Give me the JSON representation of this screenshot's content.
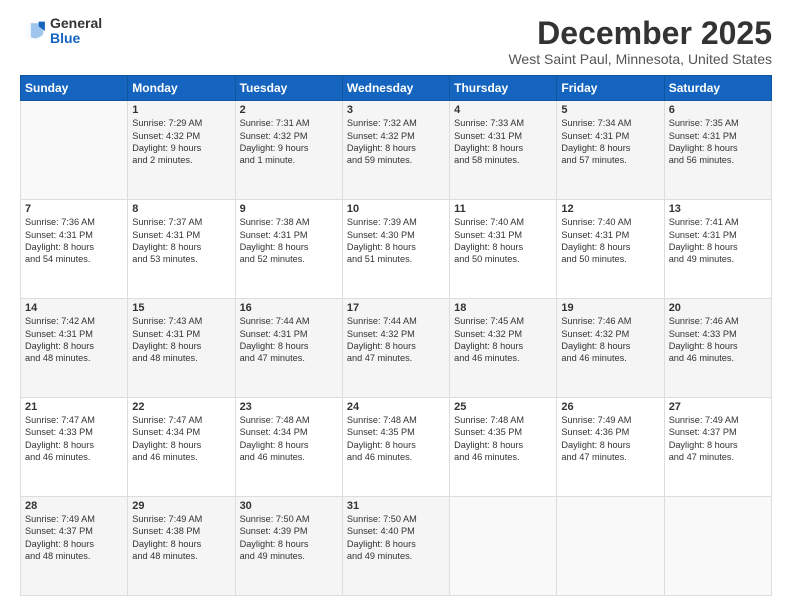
{
  "logo": {
    "general": "General",
    "blue": "Blue"
  },
  "title": "December 2025",
  "location": "West Saint Paul, Minnesota, United States",
  "days_of_week": [
    "Sunday",
    "Monday",
    "Tuesday",
    "Wednesday",
    "Thursday",
    "Friday",
    "Saturday"
  ],
  "weeks": [
    [
      {
        "day": "",
        "info": ""
      },
      {
        "day": "1",
        "info": "Sunrise: 7:29 AM\nSunset: 4:32 PM\nDaylight: 9 hours\nand 2 minutes."
      },
      {
        "day": "2",
        "info": "Sunrise: 7:31 AM\nSunset: 4:32 PM\nDaylight: 9 hours\nand 1 minute."
      },
      {
        "day": "3",
        "info": "Sunrise: 7:32 AM\nSunset: 4:32 PM\nDaylight: 8 hours\nand 59 minutes."
      },
      {
        "day": "4",
        "info": "Sunrise: 7:33 AM\nSunset: 4:31 PM\nDaylight: 8 hours\nand 58 minutes."
      },
      {
        "day": "5",
        "info": "Sunrise: 7:34 AM\nSunset: 4:31 PM\nDaylight: 8 hours\nand 57 minutes."
      },
      {
        "day": "6",
        "info": "Sunrise: 7:35 AM\nSunset: 4:31 PM\nDaylight: 8 hours\nand 56 minutes."
      }
    ],
    [
      {
        "day": "7",
        "info": "Sunrise: 7:36 AM\nSunset: 4:31 PM\nDaylight: 8 hours\nand 54 minutes."
      },
      {
        "day": "8",
        "info": "Sunrise: 7:37 AM\nSunset: 4:31 PM\nDaylight: 8 hours\nand 53 minutes."
      },
      {
        "day": "9",
        "info": "Sunrise: 7:38 AM\nSunset: 4:31 PM\nDaylight: 8 hours\nand 52 minutes."
      },
      {
        "day": "10",
        "info": "Sunrise: 7:39 AM\nSunset: 4:30 PM\nDaylight: 8 hours\nand 51 minutes."
      },
      {
        "day": "11",
        "info": "Sunrise: 7:40 AM\nSunset: 4:31 PM\nDaylight: 8 hours\nand 50 minutes."
      },
      {
        "day": "12",
        "info": "Sunrise: 7:40 AM\nSunset: 4:31 PM\nDaylight: 8 hours\nand 50 minutes."
      },
      {
        "day": "13",
        "info": "Sunrise: 7:41 AM\nSunset: 4:31 PM\nDaylight: 8 hours\nand 49 minutes."
      }
    ],
    [
      {
        "day": "14",
        "info": "Sunrise: 7:42 AM\nSunset: 4:31 PM\nDaylight: 8 hours\nand 48 minutes."
      },
      {
        "day": "15",
        "info": "Sunrise: 7:43 AM\nSunset: 4:31 PM\nDaylight: 8 hours\nand 48 minutes."
      },
      {
        "day": "16",
        "info": "Sunrise: 7:44 AM\nSunset: 4:31 PM\nDaylight: 8 hours\nand 47 minutes."
      },
      {
        "day": "17",
        "info": "Sunrise: 7:44 AM\nSunset: 4:32 PM\nDaylight: 8 hours\nand 47 minutes."
      },
      {
        "day": "18",
        "info": "Sunrise: 7:45 AM\nSunset: 4:32 PM\nDaylight: 8 hours\nand 46 minutes."
      },
      {
        "day": "19",
        "info": "Sunrise: 7:46 AM\nSunset: 4:32 PM\nDaylight: 8 hours\nand 46 minutes."
      },
      {
        "day": "20",
        "info": "Sunrise: 7:46 AM\nSunset: 4:33 PM\nDaylight: 8 hours\nand 46 minutes."
      }
    ],
    [
      {
        "day": "21",
        "info": "Sunrise: 7:47 AM\nSunset: 4:33 PM\nDaylight: 8 hours\nand 46 minutes."
      },
      {
        "day": "22",
        "info": "Sunrise: 7:47 AM\nSunset: 4:34 PM\nDaylight: 8 hours\nand 46 minutes."
      },
      {
        "day": "23",
        "info": "Sunrise: 7:48 AM\nSunset: 4:34 PM\nDaylight: 8 hours\nand 46 minutes."
      },
      {
        "day": "24",
        "info": "Sunrise: 7:48 AM\nSunset: 4:35 PM\nDaylight: 8 hours\nand 46 minutes."
      },
      {
        "day": "25",
        "info": "Sunrise: 7:48 AM\nSunset: 4:35 PM\nDaylight: 8 hours\nand 46 minutes."
      },
      {
        "day": "26",
        "info": "Sunrise: 7:49 AM\nSunset: 4:36 PM\nDaylight: 8 hours\nand 47 minutes."
      },
      {
        "day": "27",
        "info": "Sunrise: 7:49 AM\nSunset: 4:37 PM\nDaylight: 8 hours\nand 47 minutes."
      }
    ],
    [
      {
        "day": "28",
        "info": "Sunrise: 7:49 AM\nSunset: 4:37 PM\nDaylight: 8 hours\nand 48 minutes."
      },
      {
        "day": "29",
        "info": "Sunrise: 7:49 AM\nSunset: 4:38 PM\nDaylight: 8 hours\nand 48 minutes."
      },
      {
        "day": "30",
        "info": "Sunrise: 7:50 AM\nSunset: 4:39 PM\nDaylight: 8 hours\nand 49 minutes."
      },
      {
        "day": "31",
        "info": "Sunrise: 7:50 AM\nSunset: 4:40 PM\nDaylight: 8 hours\nand 49 minutes."
      },
      {
        "day": "",
        "info": ""
      },
      {
        "day": "",
        "info": ""
      },
      {
        "day": "",
        "info": ""
      }
    ]
  ]
}
